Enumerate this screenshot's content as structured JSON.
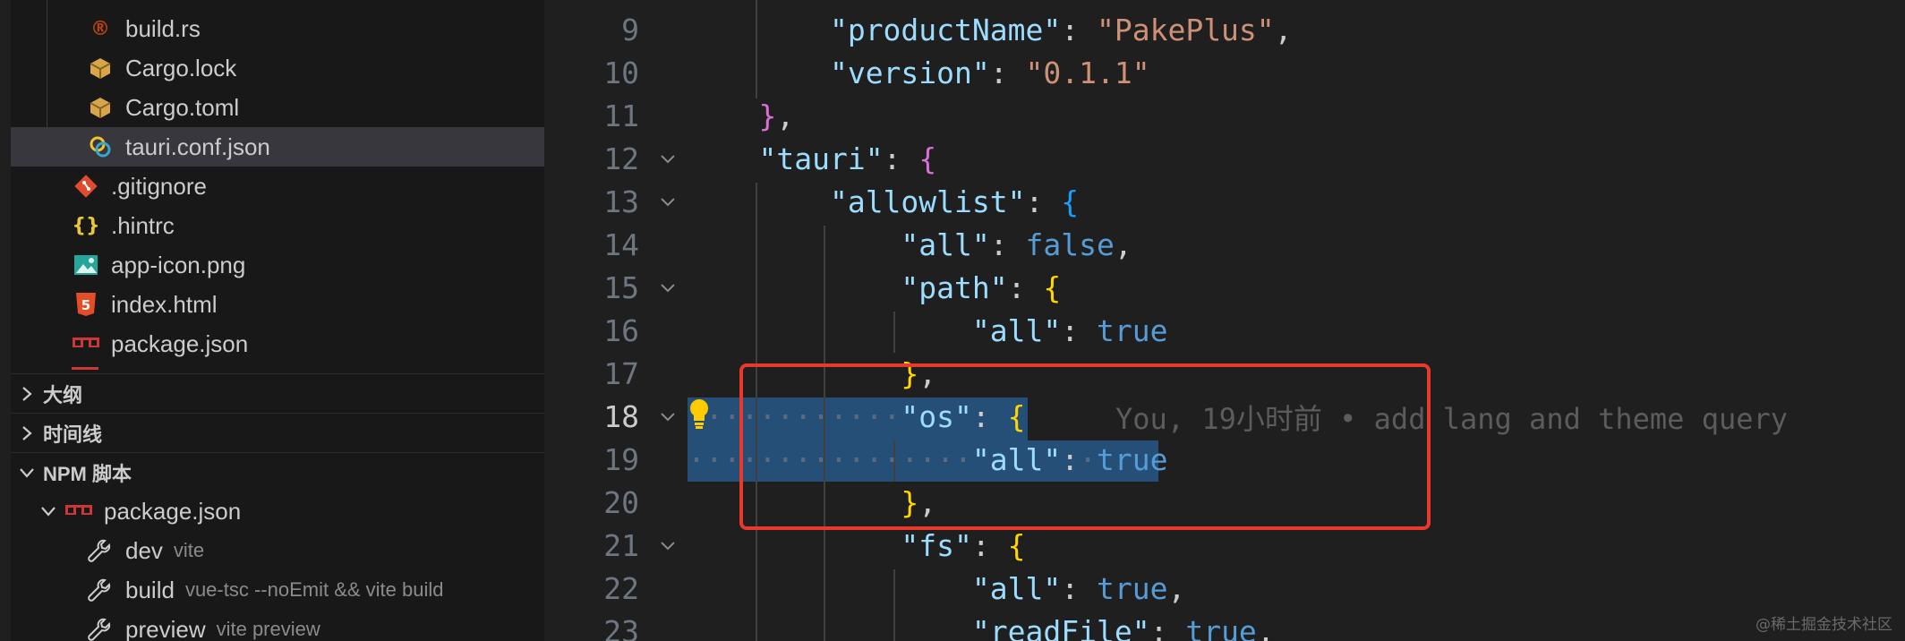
{
  "explorer": {
    "files": [
      {
        "name": "build.rs",
        "icon": "rust-file-icon",
        "glyph": "®",
        "color": "#b7410e"
      },
      {
        "name": "Cargo.lock",
        "icon": "cargo-package-icon",
        "glyph": "▣",
        "color": "#d7a64a"
      },
      {
        "name": "Cargo.toml",
        "icon": "cargo-package-icon",
        "glyph": "▣",
        "color": "#d7a64a"
      },
      {
        "name": "tauri.conf.json",
        "icon": "tauri-icon",
        "glyph": "◎",
        "color": "#38a6c8"
      },
      {
        "name": ".gitignore",
        "icon": "git-icon",
        "glyph": "◆",
        "color": "#e04a2f"
      },
      {
        "name": ".hintrc",
        "icon": "json-braces-icon",
        "glyph": "{ }",
        "color": "#e8c53d"
      },
      {
        "name": "app-icon.png",
        "icon": "image-icon",
        "glyph": "▧",
        "color": "#26a69a"
      },
      {
        "name": "index.html",
        "icon": "html5-icon",
        "glyph": "5",
        "color": "#e44d26"
      },
      {
        "name": "package.json",
        "icon": "npm-icon",
        "glyph": "npm",
        "color": "#cb3837"
      }
    ]
  },
  "sections": {
    "outline": "大纲",
    "timeline": "时间线",
    "npm_scripts": "NPM 脚本"
  },
  "npm": {
    "package": "package.json",
    "scripts": [
      {
        "name": "dev",
        "cmd": "vite"
      },
      {
        "name": "build",
        "cmd": "vue-tsc --noEmit && vite build"
      },
      {
        "name": "preview",
        "cmd": "vite preview"
      }
    ]
  },
  "editor": {
    "line_numbers": [
      "9",
      "10",
      "11",
      "12",
      "13",
      "14",
      "15",
      "16",
      "17",
      "18",
      "19",
      "20",
      "21",
      "22",
      "23"
    ],
    "active_line": "18",
    "blame": "You, 19小时前 • add lang and theme query"
  },
  "watermark": "@稀土掘金技术社区",
  "colors": {
    "accent_selection": "#264f78",
    "highlight_box": "#e8392c"
  }
}
